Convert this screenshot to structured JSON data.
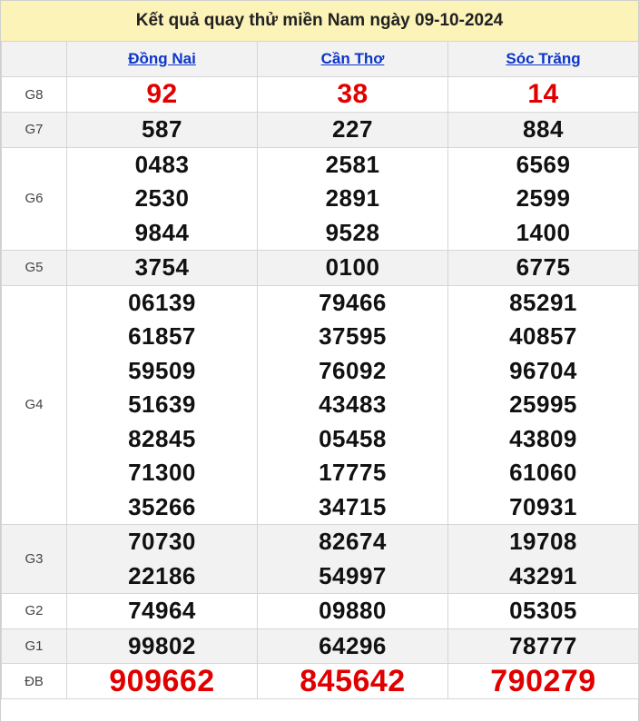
{
  "title": "Kết quả quay thử miền Nam ngày 09-10-2024",
  "provinces": [
    "Đồng Nai",
    "Cần Thơ",
    "Sóc Trăng"
  ],
  "prizes": [
    {
      "label": "G8",
      "values": [
        [
          "92"
        ],
        [
          "38"
        ],
        [
          "14"
        ]
      ]
    },
    {
      "label": "G7",
      "values": [
        [
          "587"
        ],
        [
          "227"
        ],
        [
          "884"
        ]
      ]
    },
    {
      "label": "G6",
      "values": [
        [
          "0483",
          "2530",
          "9844"
        ],
        [
          "2581",
          "2891",
          "9528"
        ],
        [
          "6569",
          "2599",
          "1400"
        ]
      ]
    },
    {
      "label": "G5",
      "values": [
        [
          "3754"
        ],
        [
          "0100"
        ],
        [
          "6775"
        ]
      ]
    },
    {
      "label": "G4",
      "values": [
        [
          "06139",
          "61857",
          "59509",
          "51639",
          "82845",
          "71300",
          "35266"
        ],
        [
          "79466",
          "37595",
          "76092",
          "43483",
          "05458",
          "17775",
          "34715"
        ],
        [
          "85291",
          "40857",
          "96704",
          "25995",
          "43809",
          "61060",
          "70931"
        ]
      ]
    },
    {
      "label": "G3",
      "values": [
        [
          "70730",
          "22186"
        ],
        [
          "82674",
          "54997"
        ],
        [
          "19708",
          "43291"
        ]
      ]
    },
    {
      "label": "G2",
      "values": [
        [
          "74964"
        ],
        [
          "09880"
        ],
        [
          "05305"
        ]
      ]
    },
    {
      "label": "G1",
      "values": [
        [
          "99802"
        ],
        [
          "64296"
        ],
        [
          "78777"
        ]
      ]
    },
    {
      "label": "ĐB",
      "values": [
        [
          "909662"
        ],
        [
          "845642"
        ],
        [
          "790279"
        ]
      ]
    }
  ],
  "colors": {
    "title_bg": "#fbf3b8",
    "link": "#0c35c9",
    "highlight": "#e00000",
    "row_alt": "#f2f2f2"
  }
}
